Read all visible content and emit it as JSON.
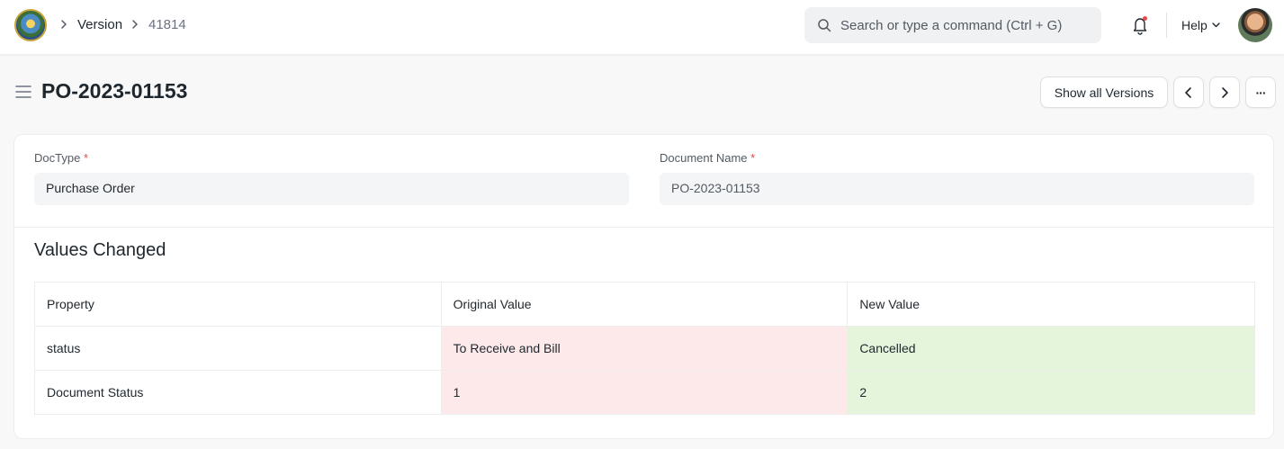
{
  "navbar": {
    "breadcrumbs": [
      "Version",
      "41814"
    ],
    "search_placeholder": "Search or type a command (Ctrl + G)",
    "help_label": "Help"
  },
  "page": {
    "title": "PO-2023-01153",
    "actions": {
      "show_versions_label": "Show all Versions",
      "prev_icon": "chevron-left-icon",
      "next_icon": "chevron-right-icon",
      "more_label": "···"
    }
  },
  "form": {
    "doctype": {
      "label": "DocType",
      "required": "*",
      "value": "Purchase Order"
    },
    "docname": {
      "label": "Document Name",
      "required": "*",
      "value": "PO-2023-01153"
    }
  },
  "values_changed": {
    "title": "Values Changed",
    "columns": [
      "Property",
      "Original Value",
      "New Value"
    ],
    "rows": [
      {
        "property": "status",
        "original": "To Receive and Bill",
        "new": "Cancelled"
      },
      {
        "property": "Document Status",
        "original": "1",
        "new": "2"
      }
    ]
  },
  "colors": {
    "original_bg": "#fde9e9",
    "new_bg": "#e4f5dc",
    "required": "#e24c4c",
    "notification_dot": "#e24c4c"
  }
}
